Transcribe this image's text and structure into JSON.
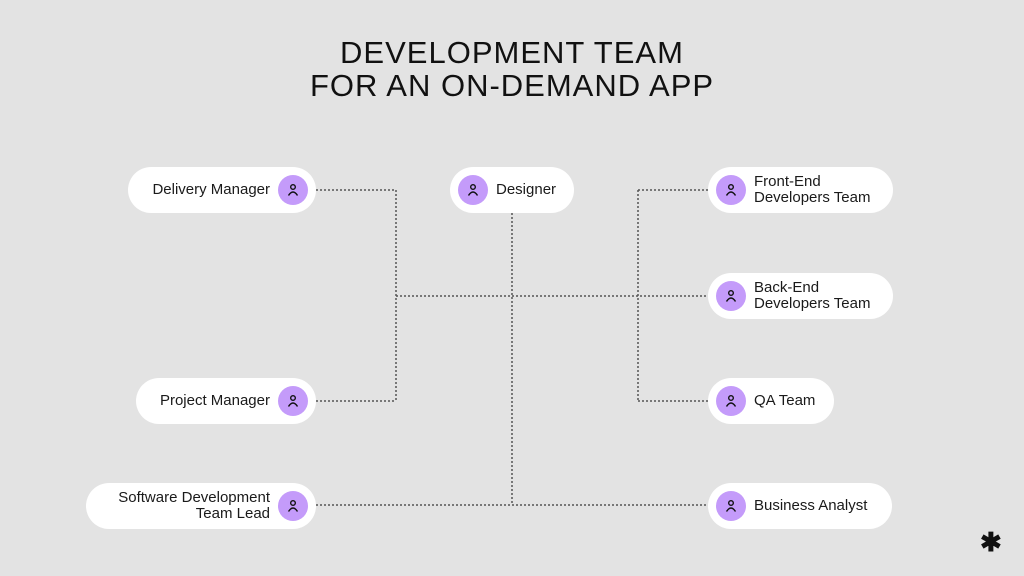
{
  "title": {
    "line1": "DEVELOPMENT TEAM",
    "line2": "FOR AN ON-DEMAND APP"
  },
  "nodes": {
    "delivery_manager": {
      "label": "Delivery Manager",
      "icon": "person-icon"
    },
    "designer": {
      "label": "Designer",
      "icon": "person-icon"
    },
    "frontend": {
      "line1": "Front-End",
      "line2": "Developers Team",
      "icon": "person-icon"
    },
    "backend": {
      "line1": "Back-End",
      "line2": "Developers Team",
      "icon": "person-icon"
    },
    "project_manager": {
      "label": "Project Manager",
      "icon": "person-icon"
    },
    "qa": {
      "label": "QA Team",
      "icon": "person-icon"
    },
    "team_lead": {
      "line1": "Software Development",
      "line2": "Team Lead",
      "icon": "person-icon"
    },
    "business_analyst": {
      "label": "Business Analyst",
      "icon": "person-icon"
    }
  },
  "colors": {
    "background": "#e3e3e3",
    "node": "#ffffff",
    "avatar": "#c49bfa",
    "connector": "#555555"
  },
  "logo": {
    "glyph": "✱",
    "icon": "asterisk-logo-icon"
  }
}
